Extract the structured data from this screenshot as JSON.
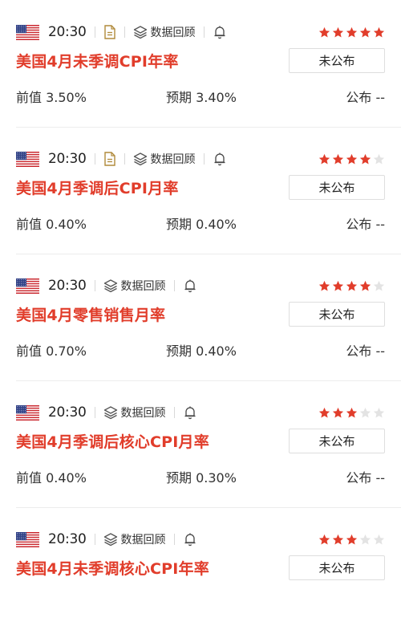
{
  "common": {
    "review_label": "数据回顾",
    "prev_label": "前值",
    "forecast_label": "预期",
    "actual_label": "公布"
  },
  "events": [
    {
      "time": "20:30",
      "flag": "us-flag-icon",
      "has_doc": true,
      "title": "美国4月未季调CPI年率",
      "status": "未公布",
      "prev": "3.50%",
      "forecast": "3.40%",
      "actual": "--",
      "stars": 5,
      "star_max": 5
    },
    {
      "time": "20:30",
      "flag": "us-flag-icon",
      "has_doc": true,
      "title": "美国4月季调后CPI月率",
      "status": "未公布",
      "prev": "0.40%",
      "forecast": "0.40%",
      "actual": "--",
      "stars": 4,
      "star_max": 5
    },
    {
      "time": "20:30",
      "flag": "us-flag-icon",
      "has_doc": false,
      "title": "美国4月零售销售月率",
      "status": "未公布",
      "prev": "0.70%",
      "forecast": "0.40%",
      "actual": "--",
      "stars": 4,
      "star_max": 5
    },
    {
      "time": "20:30",
      "flag": "us-flag-icon",
      "has_doc": false,
      "title": "美国4月季调后核心CPI月率",
      "status": "未公布",
      "prev": "0.40%",
      "forecast": "0.30%",
      "actual": "--",
      "stars": 3,
      "star_max": 5
    },
    {
      "time": "20:30",
      "flag": "us-flag-icon",
      "has_doc": false,
      "title": "美国4月未季调核心CPI年率",
      "status": "未公布",
      "prev": "",
      "forecast": "",
      "actual": "",
      "stars": 3,
      "star_max": 5
    }
  ],
  "colors": {
    "accent": "#e13d2b",
    "star_on": "#e13d2b",
    "star_off": "#e3e3e3"
  }
}
